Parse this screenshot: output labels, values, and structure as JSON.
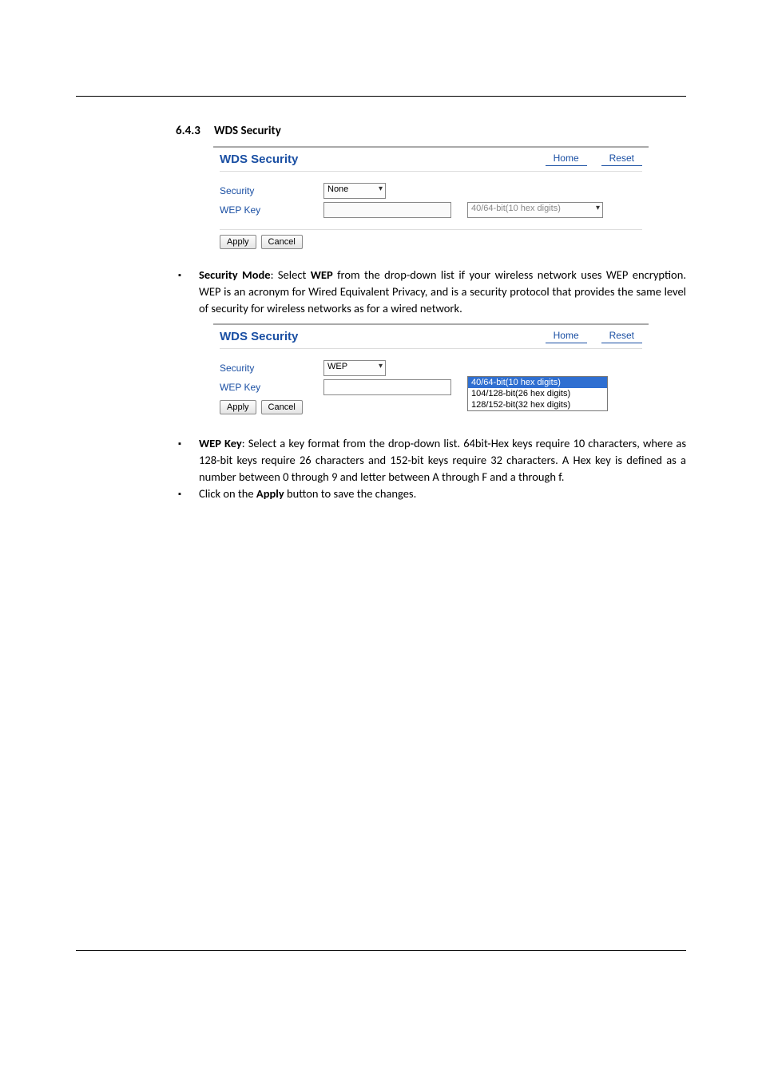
{
  "section": {
    "number": "6.4.3",
    "title": "WDS Security"
  },
  "panel1": {
    "title": "WDS Security",
    "links": {
      "home": "Home",
      "reset": "Reset"
    },
    "securityLabel": "Security",
    "securityValue": "None",
    "wepKeyLabel": "WEP Key",
    "wepKeyValue": "",
    "wepSelValue": "40/64-bit(10 hex digits)",
    "apply": "Apply",
    "cancel": "Cancel"
  },
  "bullet1": {
    "label": "Security Mode",
    "sep": ": Select ",
    "wep": "WEP",
    "rest": " from the drop-down list if your wireless network uses WEP encryption. WEP is an acronym for Wired Equivalent Privacy, and is a security protocol that provides the same level of security for wireless networks as for a wired network."
  },
  "panel2": {
    "title": "WDS Security",
    "links": {
      "home": "Home",
      "reset": "Reset"
    },
    "securityLabel": "Security",
    "securityValue": "WEP",
    "wepKeyLabel": "WEP Key",
    "wepKeyValue": "",
    "wepSelValue": "40/64-bit(10 hex digits)",
    "dd": {
      "o1": "40/64-bit(10 hex digits)",
      "o2": "104/128-bit(26 hex digits)",
      "o3": "128/152-bit(32 hex digits)"
    },
    "apply": "Apply",
    "cancel": "Cancel"
  },
  "bullet2": {
    "label": "WEP Key",
    "rest": ": Select a key format from the drop-down list. 64bit-Hex keys require 10 characters, where as 128-bit keys require 26 characters and 152-bit keys require 32 characters. A Hex key is defined as a number between 0 through 9 and letter between A through F and a through f."
  },
  "bullet3": {
    "pre": "Click on the ",
    "apply": "Apply",
    "post": " button to save the changes."
  }
}
